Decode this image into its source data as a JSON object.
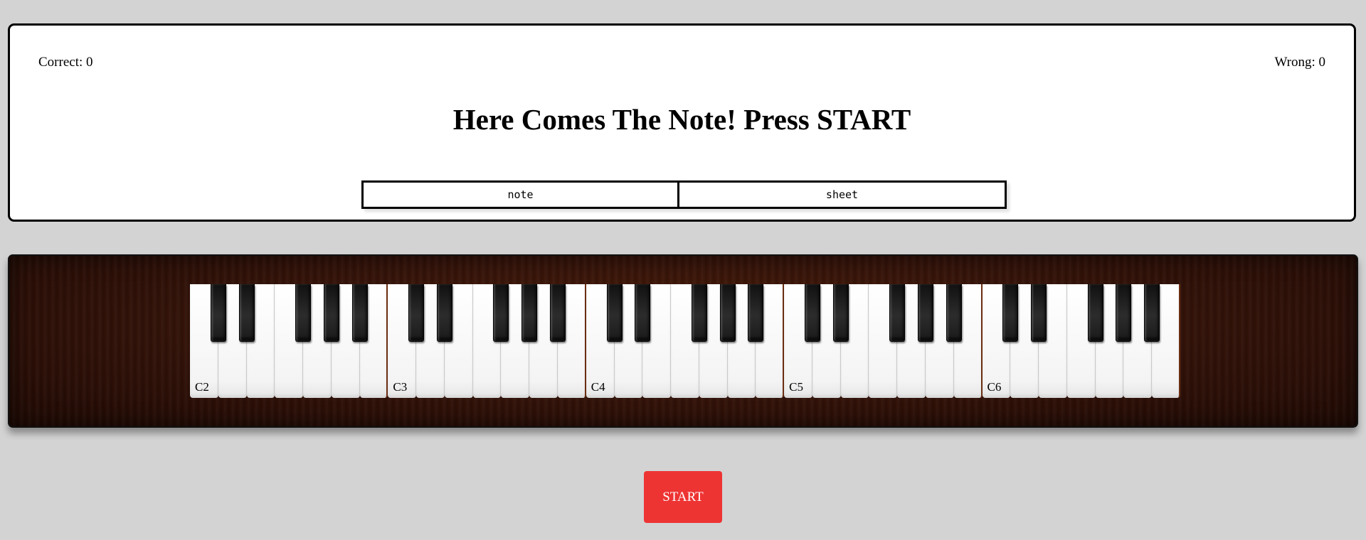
{
  "score": {
    "correct_label": "Correct: 0",
    "wrong_label": "Wrong: 0"
  },
  "title": "Here Comes The Note! Press START",
  "modes": {
    "note_label": "note",
    "sheet_label": "sheet"
  },
  "piano": {
    "octave_labels": [
      "C2",
      "C3",
      "C4",
      "C5",
      "C6"
    ],
    "octave_count": 5,
    "colors": {
      "wood": "#36140a",
      "white_key": "#ffffff",
      "black_key": "#1a1a1a"
    }
  },
  "start_label": "START",
  "colors": {
    "background": "#d3d3d3",
    "start_button": "#ee3333"
  }
}
